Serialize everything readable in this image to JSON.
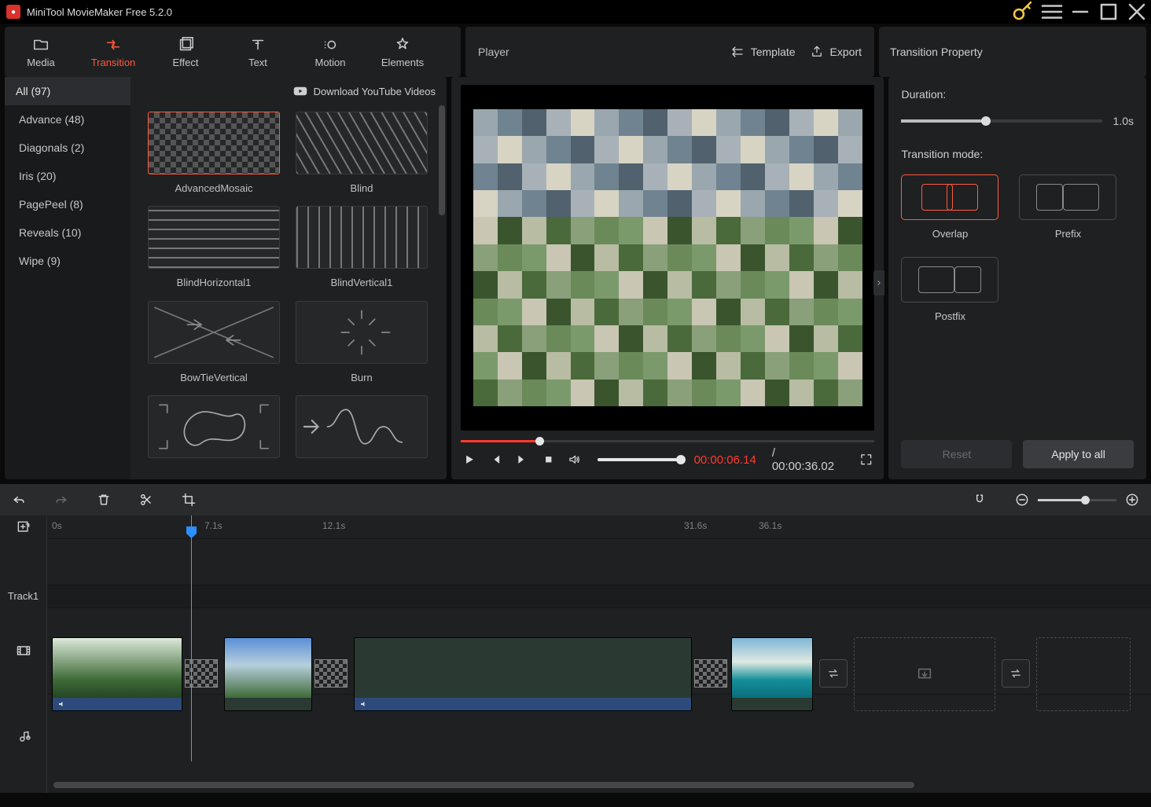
{
  "app": {
    "title": "MiniTool MovieMaker Free 5.2.0"
  },
  "ribbon": {
    "tabs": [
      {
        "id": "media",
        "label": "Media"
      },
      {
        "id": "transition",
        "label": "Transition"
      },
      {
        "id": "effect",
        "label": "Effect"
      },
      {
        "id": "text",
        "label": "Text"
      },
      {
        "id": "motion",
        "label": "Motion"
      },
      {
        "id": "elements",
        "label": "Elements"
      }
    ],
    "active": "transition"
  },
  "player": {
    "title": "Player",
    "template_btn": "Template",
    "export_btn": "Export",
    "current_tc": "00:00:06.14",
    "total_tc": "/ 00:00:36.02"
  },
  "property_panel": {
    "title": "Transition Property",
    "duration_label": "Duration:",
    "duration_value": "1.0s",
    "mode_label": "Transition mode:",
    "modes": [
      {
        "id": "overlap",
        "label": "Overlap"
      },
      {
        "id": "prefix",
        "label": "Prefix"
      },
      {
        "id": "postfix",
        "label": "Postfix"
      }
    ],
    "selected_mode": "overlap",
    "reset": "Reset",
    "apply_all": "Apply to all"
  },
  "browser": {
    "head": "All (97)",
    "download_label": "Download YouTube Videos",
    "categories": [
      "Advance (48)",
      "Diagonals (2)",
      "Iris (20)",
      "PagePeel (8)",
      "Reveals (10)",
      "Wipe (9)"
    ],
    "items": [
      {
        "name": "AdvancedMosaic",
        "pattern": "checker",
        "selected": true
      },
      {
        "name": "Blind",
        "pattern": "diag"
      },
      {
        "name": "BlindHorizontal1",
        "pattern": "hlines"
      },
      {
        "name": "BlindVertical1",
        "pattern": "vlines"
      },
      {
        "name": "BowTieVertical",
        "pattern": "bowtie"
      },
      {
        "name": "Burn",
        "pattern": "burn"
      },
      {
        "name": "",
        "pattern": "blob"
      },
      {
        "name": "",
        "pattern": "wave"
      }
    ]
  },
  "timeline": {
    "marks": [
      "0s",
      "7.1s",
      "12.1s",
      "31.6s",
      "36.1s"
    ],
    "mark_pos": [
      0,
      200,
      350,
      810,
      905
    ],
    "track_label": "Track1",
    "playhead_time": "7.1s"
  }
}
